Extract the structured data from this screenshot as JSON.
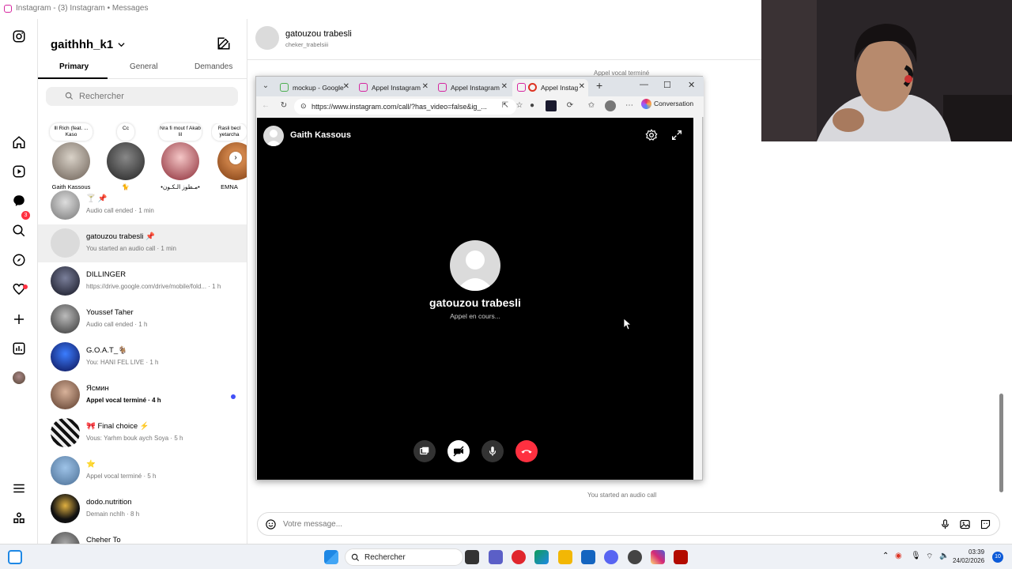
{
  "window": {
    "title": "Instagram - (3) Instagram • Messages"
  },
  "leftnav": {
    "notification_badge": "3"
  },
  "inbox": {
    "username": "gaithhh_k1",
    "tabs": [
      "Primary",
      "General",
      "Demandes"
    ],
    "search_placeholder": "Rechercher",
    "stories": [
      {
        "note": "lll Rich (feat. ... Kaso",
        "name": "Gaith Kassous"
      },
      {
        "note": "Cc",
        "name": "🐈"
      },
      {
        "note": "Nra fi mout f Akab lil",
        "name": "•مـطوز الـكـون•"
      },
      {
        "note": "Rasli becl yetarcha",
        "name": "EMNA"
      }
    ],
    "conversations": [
      {
        "name": "🍸 📌",
        "preview": "Audio call ended · 1 min",
        "bold": false
      },
      {
        "name": "gatouzou trabesli 📌",
        "preview": "You started an audio call · 1 min",
        "bold": false
      },
      {
        "name": "DILLINGER",
        "preview": "https://drive.google.com/drive/mobile/fold... · 1 h",
        "bold": false
      },
      {
        "name": "Youssef Taher",
        "preview": "Audio call ended · 1 h",
        "bold": false
      },
      {
        "name": "G.O.A.T_🐐",
        "preview": "You: HANI FEL LIVE · 1 h",
        "bold": false
      },
      {
        "name": "Ясмин",
        "preview": "Appel vocal terminé · 4 h",
        "bold": true
      },
      {
        "name": "🎀 Final choice ⚡",
        "preview": "Vous: Yarhm bouk aych Soya · 5 h",
        "bold": false
      },
      {
        "name": "⭐",
        "preview": "Appel vocal terminé · 5 h",
        "bold": false
      },
      {
        "name": "dodo.nutrition",
        "preview": "Demain nchlh · 8 h",
        "bold": false
      },
      {
        "name": "Cheher To",
        "preview": "",
        "bold": false
      }
    ]
  },
  "chat": {
    "name": "gatouzou trabesli",
    "handle": "cheker_trabelsiii",
    "system_top": "Appel vocal terminé",
    "system_bottom": "You started an audio call",
    "message_placeholder": "Votre message..."
  },
  "browser": {
    "tabs": [
      "mockup - Google",
      "Appel Instagram",
      "Appel Instagram",
      "Appel Instag"
    ],
    "url": "https://www.instagram.com/call/?has_video=false&ig_...",
    "conversation_label": "Conversation",
    "call": {
      "header_name": "Gaith Kassous",
      "callee": "gatouzou trabesli",
      "status": "Appel en cours..."
    }
  },
  "taskbar": {
    "search": "Rechercher",
    "time": "03:39",
    "date": "24/02/2026",
    "notifications": "10"
  },
  "colors": {
    "accent_blue": "#4150f7",
    "call_end": "#ff3040",
    "taskbar": "#eef1f6"
  }
}
